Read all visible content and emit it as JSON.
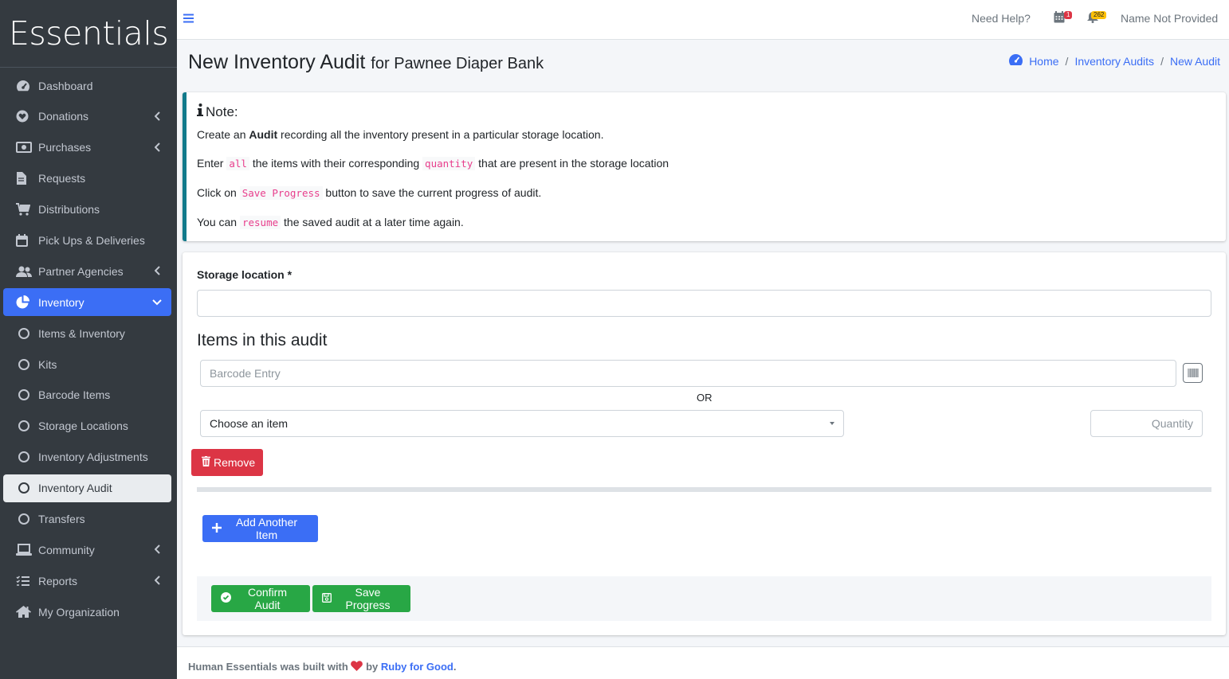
{
  "brand": {
    "name": "Essentials"
  },
  "sidebar": {
    "items": [
      {
        "label": "Dashboard",
        "icon": "dashboard-gauge-icon"
      },
      {
        "label": "Donations",
        "icon": "heart-icon",
        "has_chevron": true
      },
      {
        "label": "Purchases",
        "icon": "money-bill-icon",
        "has_chevron": true
      },
      {
        "label": "Requests",
        "icon": "file-icon"
      },
      {
        "label": "Distributions",
        "icon": "cart-icon"
      },
      {
        "label": "Pick Ups & Deliveries",
        "icon": "calendar-icon"
      },
      {
        "label": "Partner Agencies",
        "icon": "users-icon",
        "has_chevron": true
      },
      {
        "label": "Inventory",
        "icon": "pie-chart-icon",
        "active": true
      },
      {
        "label": "Items & Inventory",
        "icon": "circle-icon"
      },
      {
        "label": "Kits",
        "icon": "circle-icon"
      },
      {
        "label": "Barcode Items",
        "icon": "circle-icon"
      },
      {
        "label": "Storage Locations",
        "icon": "circle-icon"
      },
      {
        "label": "Inventory Adjustments",
        "icon": "circle-icon"
      },
      {
        "label": "Inventory Audit",
        "icon": "circle-icon",
        "selected": true
      },
      {
        "label": "Transfers",
        "icon": "circle-icon"
      },
      {
        "label": "Community",
        "icon": "laptop-icon",
        "has_chevron": true
      },
      {
        "label": "Reports",
        "icon": "list-icon",
        "has_chevron": true
      },
      {
        "label": "My Organization",
        "icon": "home-icon"
      }
    ]
  },
  "topbar": {
    "need_help": "Need Help?",
    "calendar_badge": "1",
    "bell_badge": "262",
    "user_name": "Name Not Provided"
  },
  "header": {
    "title": "New Inventory Audit",
    "subtitle": "for Pawnee Diaper Bank",
    "breadcrumb": {
      "home": "Home",
      "audits": "Inventory Audits",
      "current": "New Audit"
    }
  },
  "note": {
    "title": "Note:",
    "line1_pre": "Create an ",
    "line1_bold": "Audit",
    "line1_post": " recording all the inventory present in a particular storage location.",
    "line2_pre": "Enter ",
    "line2_code1": "all",
    "line2_mid": " the items with their corresponding ",
    "line2_code2": "quantity",
    "line2_post": " that are present in the storage location",
    "line3_pre": "Click on ",
    "line3_code": "Save Progress",
    "line3_post": " button to save the current progress of audit.",
    "line4_pre": "You can ",
    "line4_code": "resume",
    "line4_post": " the saved audit at a later time again."
  },
  "form": {
    "storage_label": "Storage location *",
    "storage_value": "",
    "items_title": "Items in this audit",
    "barcode_placeholder": "Barcode Entry",
    "or_text": "OR",
    "item_select_value": "Choose an item",
    "quantity_placeholder": "Quantity",
    "remove_label": "Remove",
    "add_item_label": "Add Another Item",
    "confirm_label": "Confirm Audit",
    "save_label": "Save Progress"
  },
  "footer": {
    "text_pre": "Human Essentials was built with",
    "text_by": "by",
    "link": "Ruby for Good",
    "period": "."
  },
  "colors": {
    "sidebar_bg": "#343a40",
    "primary": "#3b6ef5",
    "danger": "#dc3545",
    "success": "#28a745",
    "callout_border": "#117a8b"
  }
}
